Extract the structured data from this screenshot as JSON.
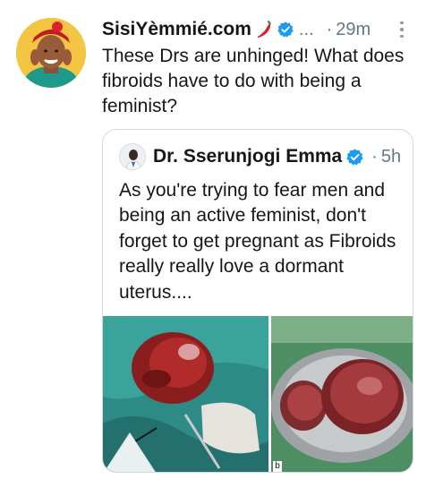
{
  "tweet": {
    "author_name": "SisiYèmmié.com",
    "handle": "...",
    "separator": "·",
    "time": "29m",
    "text": "These Drs are unhinged! What does fibroids have to do with being a feminist?",
    "icons": {
      "avatar": "profile-photo",
      "chili": "chili-pepper-icon",
      "verified": "verified-badge-icon",
      "more": "more-options-icon"
    }
  },
  "quoted_tweet": {
    "author_name": "Dr. Sserunjogi Emma",
    "separator": "·",
    "time": "5h",
    "text": "As you're trying to fear men and being an active feminist, don't forget to get pregnant as Fibroids really really love a dormant uterus....",
    "media_label": "b",
    "icons": {
      "verified": "verified-badge-icon"
    }
  },
  "colors": {
    "verified": "#1d9bf0",
    "text": "#14171a",
    "secondary": "#657786",
    "border": "#cfd9de"
  }
}
